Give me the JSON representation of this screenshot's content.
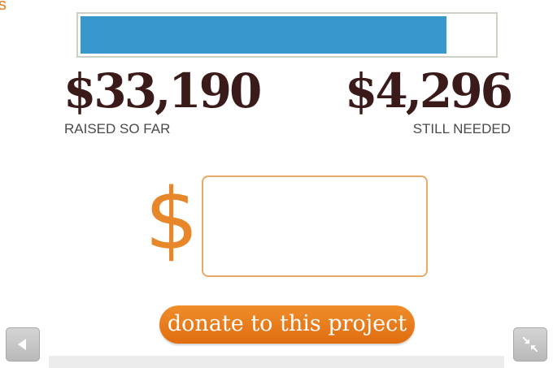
{
  "edge_text": "s",
  "progress": {
    "fraction_raised": 0.8853
  },
  "raised": {
    "amount": "$33,190",
    "label": "RAISED SO FAR"
  },
  "needed": {
    "amount": "$4,296",
    "label": "STILL NEEDED"
  },
  "donation_input": {
    "currency_symbol": "$",
    "value": "",
    "placeholder": ""
  },
  "donate_button": {
    "label": "donate to this project"
  },
  "nav": {
    "back_icon": "triangle-left-icon",
    "collapse_icon": "collapse-arrows-icon"
  },
  "colors": {
    "progress_fill": "#3898cc",
    "accent_orange": "#e8862a",
    "amount_text": "#3b1a1a"
  }
}
